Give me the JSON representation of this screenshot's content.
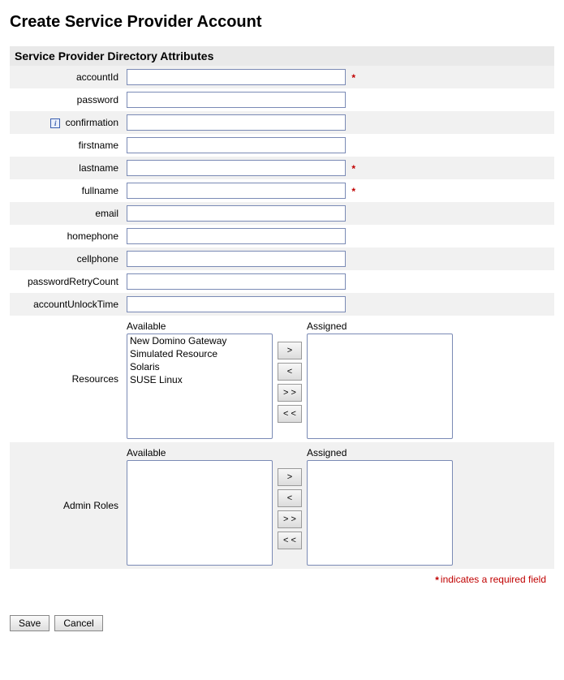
{
  "page": {
    "title": "Create Service Provider Account",
    "section_header": "Service Provider Directory Attributes",
    "required_note": "indicates a required field"
  },
  "fields": {
    "accountId": {
      "label": "accountId",
      "value": "",
      "required": true
    },
    "password": {
      "label": "password",
      "value": "",
      "required": false
    },
    "confirmation": {
      "label": "confirmation",
      "value": "",
      "required": false,
      "info": true
    },
    "firstname": {
      "label": "firstname",
      "value": "",
      "required": false
    },
    "lastname": {
      "label": "lastname",
      "value": "",
      "required": true
    },
    "fullname": {
      "label": "fullname",
      "value": "",
      "required": true
    },
    "email": {
      "label": "email",
      "value": "",
      "required": false
    },
    "homephone": {
      "label": "homephone",
      "value": "",
      "required": false
    },
    "cellphone": {
      "label": "cellphone",
      "value": "",
      "required": false
    },
    "passwordRetryCount": {
      "label": "passwordRetryCount",
      "value": "",
      "required": false
    },
    "accountUnlockTime": {
      "label": "accountUnlockTime",
      "value": "",
      "required": false
    }
  },
  "resources": {
    "label": "Resources",
    "available_label": "Available",
    "assigned_label": "Assigned",
    "available": [
      "New Domino Gateway",
      "Simulated Resource",
      "Solaris",
      "SUSE Linux"
    ],
    "assigned": []
  },
  "adminRoles": {
    "label": "Admin Roles",
    "available_label": "Available",
    "assigned_label": "Assigned",
    "available": [],
    "assigned": []
  },
  "shuttle": {
    "add": ">",
    "remove": "<",
    "add_all": "> >",
    "remove_all": "< <"
  },
  "buttons": {
    "save": "Save",
    "cancel": "Cancel"
  }
}
